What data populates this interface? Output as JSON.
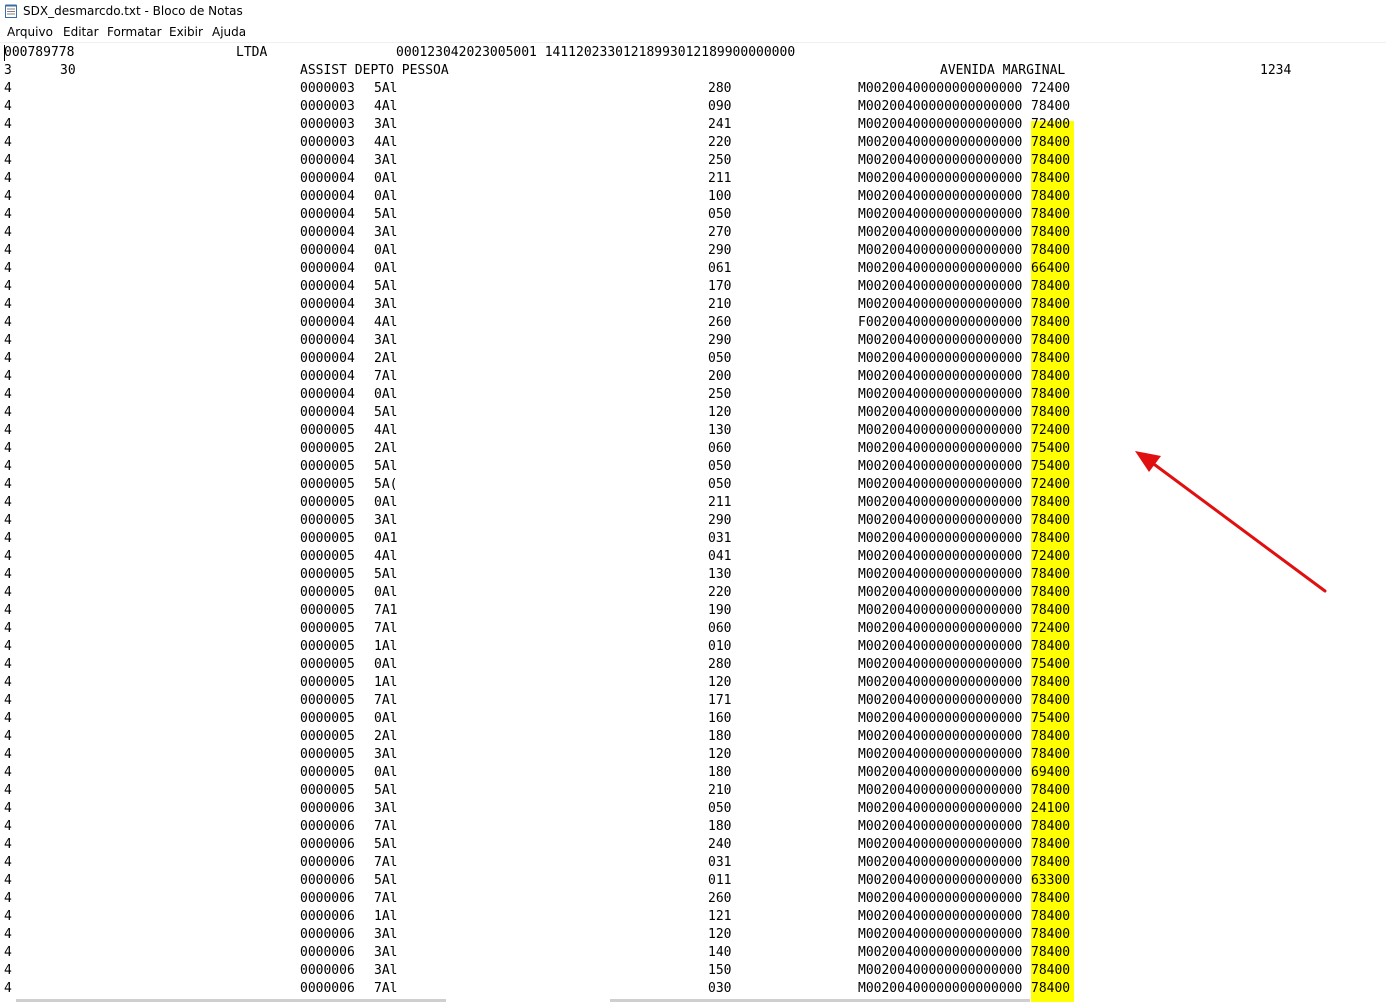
{
  "window": {
    "title": "SDX_desmarcdo.txt - Bloco de Notas",
    "icon": "notepad-icon"
  },
  "menu": [
    {
      "label": "Arquivo"
    },
    {
      "label": "Editar"
    },
    {
      "label": "Formatar"
    },
    {
      "label": "Exibir"
    },
    {
      "label": "Ajuda"
    }
  ],
  "content": {
    "header_line1": {
      "id": "000789778",
      "company": "LTDA",
      "codes": "000123042023005001 14112023301218993012189900000000"
    },
    "header_line2": {
      "type": "3",
      "code": "30",
      "name": "ASSIST DEPTO PESSOA",
      "address": "AVENIDA MARGINAL",
      "number": "1234"
    },
    "rows": [
      {
        "t": "4",
        "id": "0000003",
        "c": "5Al",
        "v": "280",
        "code": "M00200400000000000000",
        "val": "72400"
      },
      {
        "t": "4",
        "id": "0000003",
        "c": "4Al",
        "v": "090",
        "code": "M00200400000000000000",
        "val": "78400"
      },
      {
        "t": "4",
        "id": "0000003",
        "c": "3Al",
        "v": "241",
        "code": "M00200400000000000000",
        "val": "72400"
      },
      {
        "t": "4",
        "id": "0000003",
        "c": "4Al",
        "v": "220",
        "code": "M00200400000000000000",
        "val": "78400"
      },
      {
        "t": "4",
        "id": "0000004",
        "c": "3Al",
        "v": "250",
        "code": "M00200400000000000000",
        "val": "78400"
      },
      {
        "t": "4",
        "id": "0000004",
        "c": "0Al",
        "v": "211",
        "code": "M00200400000000000000",
        "val": "78400"
      },
      {
        "t": "4",
        "id": "0000004",
        "c": "0Al",
        "v": "100",
        "code": "M00200400000000000000",
        "val": "78400"
      },
      {
        "t": "4",
        "id": "0000004",
        "c": "5Al",
        "v": "050",
        "code": "M00200400000000000000",
        "val": "78400"
      },
      {
        "t": "4",
        "id": "0000004",
        "c": "3Al",
        "v": "270",
        "code": "M00200400000000000000",
        "val": "78400"
      },
      {
        "t": "4",
        "id": "0000004",
        "c": "0Al",
        "v": "290",
        "code": "M00200400000000000000",
        "val": "78400"
      },
      {
        "t": "4",
        "id": "0000004",
        "c": "0Al",
        "v": "061",
        "code": "M00200400000000000000",
        "val": "66400"
      },
      {
        "t": "4",
        "id": "0000004",
        "c": "5Al",
        "v": "170",
        "code": "M00200400000000000000",
        "val": "78400"
      },
      {
        "t": "4",
        "id": "0000004",
        "c": "3Al",
        "v": "210",
        "code": "M00200400000000000000",
        "val": "78400"
      },
      {
        "t": "4",
        "id": "0000004",
        "c": "4Al",
        "v": "260",
        "code": "F00200400000000000000",
        "val": "78400"
      },
      {
        "t": "4",
        "id": "0000004",
        "c": "3Al",
        "v": "290",
        "code": "M00200400000000000000",
        "val": "78400"
      },
      {
        "t": "4",
        "id": "0000004",
        "c": "2Al",
        "v": "050",
        "code": "M00200400000000000000",
        "val": "78400"
      },
      {
        "t": "4",
        "id": "0000004",
        "c": "7Al",
        "v": "200",
        "code": "M00200400000000000000",
        "val": "78400"
      },
      {
        "t": "4",
        "id": "0000004",
        "c": "0Al",
        "v": "250",
        "code": "M00200400000000000000",
        "val": "78400"
      },
      {
        "t": "4",
        "id": "0000004",
        "c": "5Al",
        "v": "120",
        "code": "M00200400000000000000",
        "val": "78400"
      },
      {
        "t": "4",
        "id": "0000005",
        "c": "4Al",
        "v": "130",
        "code": "M00200400000000000000",
        "val": "72400"
      },
      {
        "t": "4",
        "id": "0000005",
        "c": "2Al",
        "v": "060",
        "code": "M00200400000000000000",
        "val": "75400"
      },
      {
        "t": "4",
        "id": "0000005",
        "c": "5Al",
        "v": "050",
        "code": "M00200400000000000000",
        "val": "75400"
      },
      {
        "t": "4",
        "id": "0000005",
        "c": "5A(",
        "v": "050",
        "code": "M00200400000000000000",
        "val": "72400"
      },
      {
        "t": "4",
        "id": "0000005",
        "c": "0Al",
        "v": "211",
        "code": "M00200400000000000000",
        "val": "78400"
      },
      {
        "t": "4",
        "id": "0000005",
        "c": "3Al",
        "v": "290",
        "code": "M00200400000000000000",
        "val": "78400"
      },
      {
        "t": "4",
        "id": "0000005",
        "c": "0A1",
        "v": "031",
        "code": "M00200400000000000000",
        "val": "78400"
      },
      {
        "t": "4",
        "id": "0000005",
        "c": "4Al",
        "v": "041",
        "code": "M00200400000000000000",
        "val": "72400"
      },
      {
        "t": "4",
        "id": "0000005",
        "c": "5Al",
        "v": "130",
        "code": "M00200400000000000000",
        "val": "78400"
      },
      {
        "t": "4",
        "id": "0000005",
        "c": "0Al",
        "v": "220",
        "code": "M00200400000000000000",
        "val": "78400"
      },
      {
        "t": "4",
        "id": "0000005",
        "c": "7A1",
        "v": "190",
        "code": "M00200400000000000000",
        "val": "78400"
      },
      {
        "t": "4",
        "id": "0000005",
        "c": "7Al",
        "v": "060",
        "code": "M00200400000000000000",
        "val": "72400"
      },
      {
        "t": "4",
        "id": "0000005",
        "c": "1Al",
        "v": "010",
        "code": "M00200400000000000000",
        "val": "78400"
      },
      {
        "t": "4",
        "id": "0000005",
        "c": "0Al",
        "v": "280",
        "code": "M00200400000000000000",
        "val": "75400"
      },
      {
        "t": "4",
        "id": "0000005",
        "c": "1Al",
        "v": "120",
        "code": "M00200400000000000000",
        "val": "78400"
      },
      {
        "t": "4",
        "id": "0000005",
        "c": "7Al",
        "v": "171",
        "code": "M00200400000000000000",
        "val": "78400"
      },
      {
        "t": "4",
        "id": "0000005",
        "c": "0Al",
        "v": "160",
        "code": "M00200400000000000000",
        "val": "75400"
      },
      {
        "t": "4",
        "id": "0000005",
        "c": "2Al",
        "v": "180",
        "code": "M00200400000000000000",
        "val": "78400"
      },
      {
        "t": "4",
        "id": "0000005",
        "c": "3Al",
        "v": "120",
        "code": "M00200400000000000000",
        "val": "78400"
      },
      {
        "t": "4",
        "id": "0000005",
        "c": "0Al",
        "v": "180",
        "code": "M00200400000000000000",
        "val": "69400"
      },
      {
        "t": "4",
        "id": "0000005",
        "c": "5Al",
        "v": "210",
        "code": "M00200400000000000000",
        "val": "78400"
      },
      {
        "t": "4",
        "id": "0000006",
        "c": "3Al",
        "v": "050",
        "code": "M00200400000000000000",
        "val": "24100"
      },
      {
        "t": "4",
        "id": "0000006",
        "c": "7Al",
        "v": "180",
        "code": "M00200400000000000000",
        "val": "78400"
      },
      {
        "t": "4",
        "id": "0000006",
        "c": "5Al",
        "v": "240",
        "code": "M00200400000000000000",
        "val": "78400"
      },
      {
        "t": "4",
        "id": "0000006",
        "c": "7Al",
        "v": "031",
        "code": "M00200400000000000000",
        "val": "78400"
      },
      {
        "t": "4",
        "id": "0000006",
        "c": "5Al",
        "v": "011",
        "code": "M00200400000000000000",
        "val": "63300"
      },
      {
        "t": "4",
        "id": "0000006",
        "c": "7Al",
        "v": "260",
        "code": "M00200400000000000000",
        "val": "78400"
      },
      {
        "t": "4",
        "id": "0000006",
        "c": "1Al",
        "v": "121",
        "code": "M00200400000000000000",
        "val": "78400"
      },
      {
        "t": "4",
        "id": "0000006",
        "c": "3Al",
        "v": "120",
        "code": "M00200400000000000000",
        "val": "78400"
      },
      {
        "t": "4",
        "id": "0000006",
        "c": "3Al",
        "v": "140",
        "code": "M00200400000000000000",
        "val": "78400"
      },
      {
        "t": "4",
        "id": "0000006",
        "c": "3Al",
        "v": "150",
        "code": "M00200400000000000000",
        "val": "78400"
      },
      {
        "t": "4",
        "id": "0000006",
        "c": "7Al",
        "v": "030",
        "code": "M00200400000000000000",
        "val": "78400"
      }
    ]
  },
  "annotation": {
    "highlight_color": "#ffff00",
    "arrow_color": "#e01010",
    "arrow_icon": "red-arrow-annotation"
  }
}
